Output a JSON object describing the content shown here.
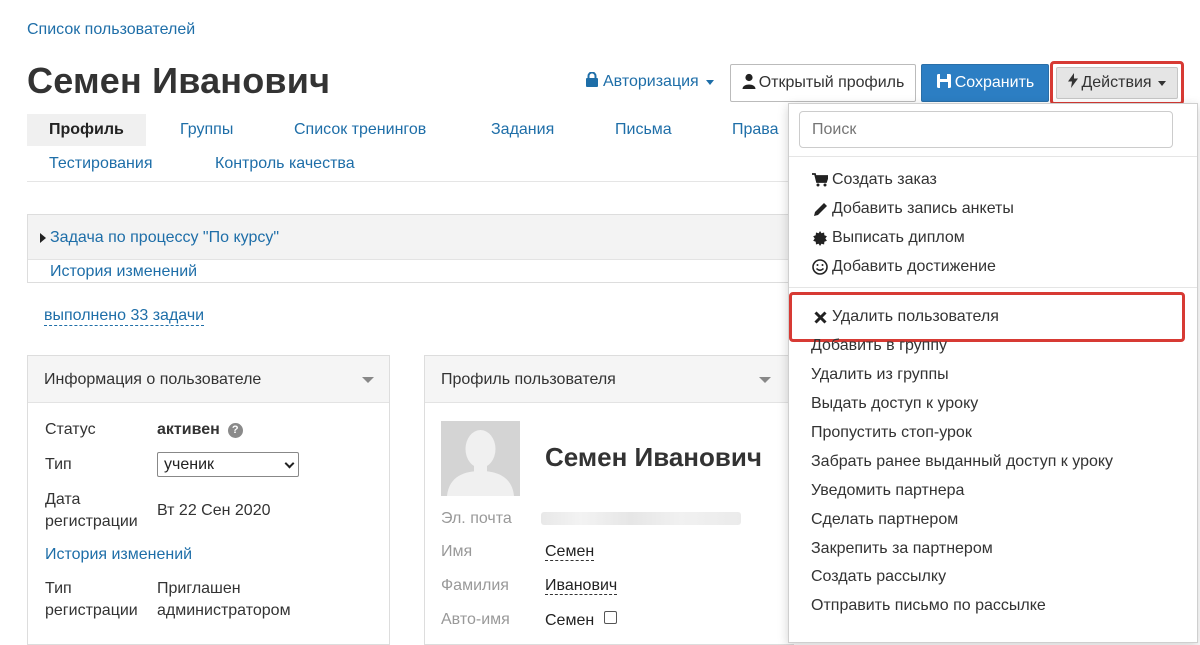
{
  "breadcrumb": "Список пользователей",
  "page_title": "Семен Иванович",
  "header": {
    "auth_label": "Авторизация",
    "open_profile_label": "Открытый профиль",
    "save_label": "Сохранить",
    "actions_label": "Действия"
  },
  "tabs": [
    "Профиль",
    "Группы",
    "Список тренингов",
    "Задания",
    "Письма",
    "Права",
    "Тестирования",
    "Контроль качества"
  ],
  "task": {
    "title": "Задача по процессу \"По курсу\"",
    "history": "История изменений"
  },
  "done_link": "выполнено 33 задачи",
  "info_panel": {
    "title": "Информация о пользователе",
    "status_label": "Статус",
    "status_value": "активен",
    "type_label": "Тип",
    "type_value": "ученик",
    "reg_date_label_1": "Дата",
    "reg_date_label_2": "регистрации",
    "reg_date_value": "Вт 22 Сен 2020",
    "history": "История изменений",
    "reg_type_label_1": "Тип",
    "reg_type_label_2": "регистрации",
    "reg_type_value_1": "Приглашен",
    "reg_type_value_2": "администратором"
  },
  "profile_panel": {
    "title": "Профиль пользователя",
    "name": "Семен Иванович",
    "email_label": "Эл. почта",
    "first_name_label": "Имя",
    "first_name_value": "Семен",
    "last_name_label": "Фамилия",
    "last_name_value": "Иванович",
    "auto_name_label": "Авто-имя",
    "auto_name_value": "Семен"
  },
  "dropdown": {
    "search_placeholder": "Поиск",
    "group1": [
      {
        "icon": "cart-icon",
        "label": "Создать заказ"
      },
      {
        "icon": "pencil-icon",
        "label": "Добавить запись анкеты"
      },
      {
        "icon": "certificate-icon",
        "label": "Выписать диплом"
      },
      {
        "icon": "smile-icon",
        "label": "Добавить достижение"
      }
    ],
    "delete_label": "Удалить пользователя",
    "group2": [
      "Добавить в группу",
      "Удалить из группы",
      "Выдать доступ к уроку",
      "Пропустить стоп-урок",
      "Забрать ранее выданный доступ к уроку",
      "Уведомить партнера",
      "Сделать партнером",
      "Закрепить за партнером",
      "Создать рассылку",
      "Отправить письмо по рассылке"
    ]
  },
  "colors": {
    "link": "#1e6ea8",
    "primary": "#2c7ec3",
    "highlight": "#d73a34"
  }
}
